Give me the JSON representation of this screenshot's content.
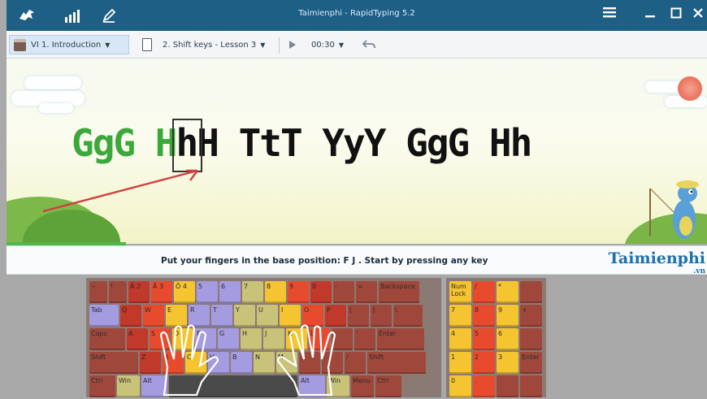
{
  "titlebar": {
    "title": "Taimienphi - RapidTyping 5.2",
    "icons": [
      "kangaroo-logo-icon",
      "stats-icon",
      "edit-icon",
      "menu-icon",
      "minimize-icon",
      "maximize-icon",
      "close-icon"
    ],
    "color": "#1e5f86"
  },
  "toolbar": {
    "course_label": "VI 1. Introduction",
    "lesson_label": "2. Shift keys - Lesson 3",
    "timer_label": "00:30"
  },
  "exercise": {
    "typed_text": "GgG H",
    "current_char": "h",
    "remaining_text": "H TtT YyY GgG Hh",
    "typed_color": "#3aa83a",
    "progress": 0.17
  },
  "info": {
    "message": "Put your fingers in the base position:  F  J .  Start by pressing any key",
    "brand": "Taimienphi",
    "brand_sub": ".vn"
  },
  "keyboard": {
    "rows": [
      [
        {
          "l": "~"
        },
        {
          "l": "!"
        },
        {
          "l": "À 2"
        },
        {
          "l": "Ã 3"
        },
        {
          "l": "Ô 4"
        },
        {
          "l": "5"
        },
        {
          "l": "6"
        },
        {
          "l": "7"
        },
        {
          "l": "8"
        },
        {
          "l": "9"
        },
        {
          "l": "0"
        },
        {
          "l": "-"
        },
        {
          "l": "="
        },
        {
          "l": "Backspace"
        }
      ],
      [
        {
          "l": "Tab"
        },
        {
          "l": "Q"
        },
        {
          "l": "W"
        },
        {
          "l": "E"
        },
        {
          "l": "R"
        },
        {
          "l": "T"
        },
        {
          "l": "Y"
        },
        {
          "l": "U"
        },
        {
          "l": "I"
        },
        {
          "l": "O"
        },
        {
          "l": "P"
        },
        {
          "l": "["
        },
        {
          "l": "]"
        },
        {
          "l": "\\"
        }
      ],
      [
        {
          "l": "Caps"
        },
        {
          "l": "A"
        },
        {
          "l": "S"
        },
        {
          "l": "D"
        },
        {
          "l": "F"
        },
        {
          "l": "G"
        },
        {
          "l": "H"
        },
        {
          "l": "J"
        },
        {
          "l": "K"
        },
        {
          "l": "L"
        },
        {
          "l": ";"
        },
        {
          "l": "'"
        },
        {
          "l": "Enter"
        }
      ],
      [
        {
          "l": "Shift"
        },
        {
          "l": "Z"
        },
        {
          "l": "X"
        },
        {
          "l": "C"
        },
        {
          "l": "V"
        },
        {
          "l": "B"
        },
        {
          "l": "N"
        },
        {
          "l": "M"
        },
        {
          "l": ","
        },
        {
          "l": "."
        },
        {
          "l": "/"
        },
        {
          "l": "Shift"
        }
      ],
      [
        {
          "l": "Ctrl"
        },
        {
          "l": "Win"
        },
        {
          "l": "Alt"
        },
        {
          "l": ""
        },
        {
          "l": "Alt"
        },
        {
          "l": "Win"
        },
        {
          "l": "Menu"
        },
        {
          "l": "Ctrl"
        }
      ]
    ],
    "numpad": [
      [
        {
          "l": "Num Lock"
        },
        {
          "l": "/"
        },
        {
          "l": "*"
        },
        {
          "l": "-"
        }
      ],
      [
        {
          "l": "7"
        },
        {
          "l": "8"
        },
        {
          "l": "9"
        },
        {
          "l": "+"
        }
      ],
      [
        {
          "l": "4"
        },
        {
          "l": "5"
        },
        {
          "l": "6"
        },
        {
          "l": ""
        }
      ],
      [
        {
          "l": "1"
        },
        {
          "l": "2"
        },
        {
          "l": "3"
        },
        {
          "l": "Enter"
        }
      ],
      [
        {
          "l": "0"
        },
        {
          "l": "."
        },
        {
          "l": ""
        },
        {
          "l": ""
        }
      ]
    ],
    "finger_colors": {
      "pinky": "#c0392b",
      "ring": "#e84a2e",
      "middle": "#f4c531",
      "index_left": "#a49be0",
      "index_right": "#c9c37a",
      "thumb": "#4a4a4a",
      "other": "#a0473c"
    }
  }
}
